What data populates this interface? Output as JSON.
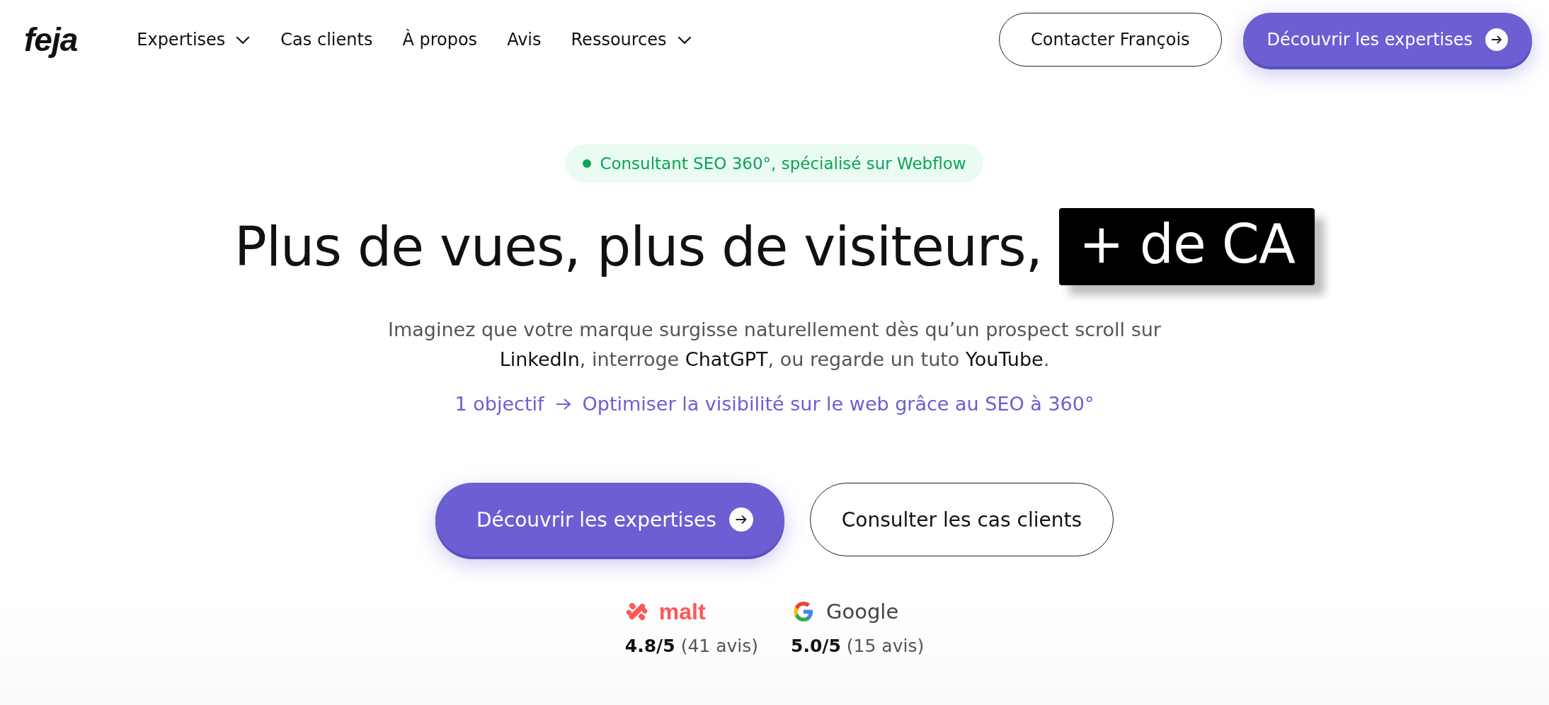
{
  "header": {
    "logo": "feja",
    "nav": [
      {
        "label": "Expertises",
        "has_menu": true
      },
      {
        "label": "Cas clients",
        "has_menu": false
      },
      {
        "label": "À propos",
        "has_menu": false
      },
      {
        "label": "Avis",
        "has_menu": false
      },
      {
        "label": "Ressources",
        "has_menu": true
      }
    ],
    "contact_button": "Contacter François",
    "cta_button": "Découvrir les expertises"
  },
  "hero": {
    "badge": "Consultant SEO 360°, spécialisé sur Webflow",
    "title": "Plus de vues, plus de visiteurs,",
    "title_highlight": "+ de CA",
    "intro": "Imaginez que votre marque surgisse naturellement dès qu’un prospect scroll sur **LinkedIn**, interroge **ChatGPT**, ou regarde un tuto **YouTube**.",
    "goal_label": "1 objectif",
    "goal_text": "Optimiser la visibilité sur le web grâce au SEO à 360°",
    "primary_button": "Découvrir les expertises",
    "secondary_button": "Consulter les cas clients",
    "ratings": [
      {
        "kind": "malt",
        "brand": "malt",
        "score": "4.8/5",
        "count": "(41 avis)"
      },
      {
        "kind": "google",
        "brand": "Google",
        "score": "5.0/5",
        "count": "(15 avis)"
      }
    ]
  }
}
